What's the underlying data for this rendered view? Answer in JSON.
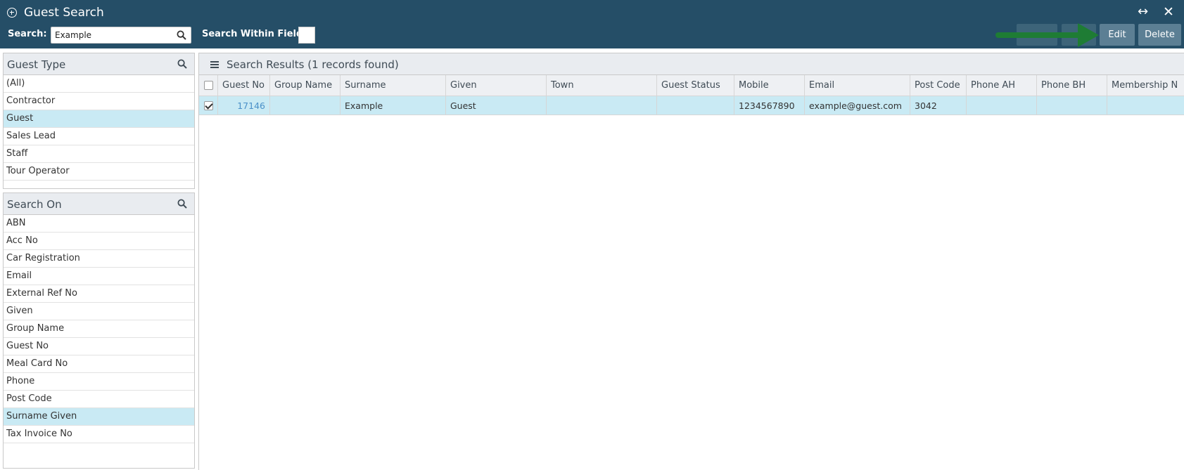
{
  "window": {
    "title": "Guest Search",
    "resize_glyph": "↔",
    "close_glyph": "✕"
  },
  "toolbar": {
    "search_label": "Search:",
    "search_value": "Example",
    "within_label": "Search Within Field:",
    "btn_edit": "Edit",
    "btn_delete": "Delete",
    "highlight_color": "#1e7c34"
  },
  "guest_type": {
    "title": "Guest Type",
    "items": [
      "(All)",
      "Contractor",
      "Guest",
      "Sales Lead",
      "Staff",
      "Tour Operator"
    ],
    "selected": "Guest"
  },
  "search_on": {
    "title": "Search On",
    "items": [
      "ABN",
      "Acc No",
      "Car Registration",
      "Email",
      "External Ref No",
      "Given",
      "Group Name",
      "Guest No",
      "Meal Card No",
      "Phone",
      "Post Code",
      "Surname Given",
      "Tax Invoice No"
    ],
    "selected": "Surname Given"
  },
  "results": {
    "title": "Search Results (1 records found)",
    "columns": [
      "Guest No",
      "Group Name",
      "Surname",
      "Given",
      "Town",
      "Guest Status",
      "Mobile",
      "Email",
      "Post Code",
      "Phone AH",
      "Phone BH",
      "Membership N"
    ],
    "rows": [
      {
        "checked": true,
        "guest_no": "17146",
        "group_name": "",
        "surname": "Example",
        "given": "Guest",
        "town": "",
        "guest_status": "",
        "mobile": "1234567890",
        "email": "example@guest.com",
        "post_code": "3042",
        "phone_ah": "",
        "phone_bh": "",
        "membership": ""
      }
    ]
  }
}
